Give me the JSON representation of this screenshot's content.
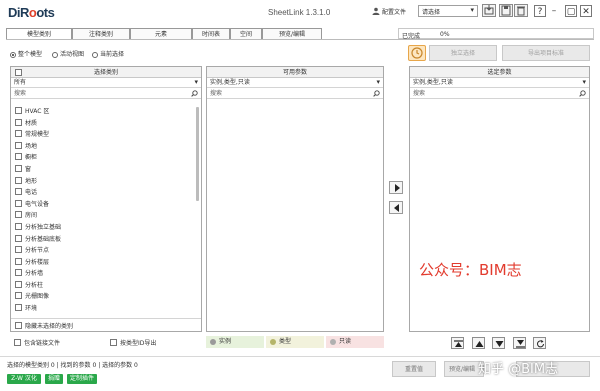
{
  "app": {
    "logo_text": "DiRoots",
    "title": "SheetLink 1.3.1.0",
    "config_label": "配置文件",
    "config_value": "请选择",
    "window_buttons": [
      "?",
      "–",
      "▢",
      "✕"
    ]
  },
  "tabs": [
    {
      "label": "模型类别",
      "active": true
    },
    {
      "label": "注释类别",
      "active": false
    },
    {
      "label": "元素",
      "active": false
    },
    {
      "label": "时间表",
      "active": false
    },
    {
      "label": "空间",
      "active": false
    },
    {
      "label": "预览/编辑",
      "active": false
    }
  ],
  "progress": {
    "label": "已完成",
    "value": "0%"
  },
  "scope": {
    "options": [
      {
        "label": "整个模型",
        "selected": true
      },
      {
        "label": "活动视图",
        "selected": false
      },
      {
        "label": "当前选择",
        "selected": false
      }
    ]
  },
  "actions": {
    "standalone": "独立选择",
    "export_standard": "导出项目标准"
  },
  "categories_panel": {
    "title": "选择类别",
    "filter_value": "所有",
    "search_placeholder": "搜索",
    "items": [
      "HVAC 区",
      "材质",
      "常规模型",
      "场地",
      "橱柜",
      "窗",
      "地形",
      "电话",
      "电气设备",
      "房间",
      "分析独立基础",
      "分析基础底板",
      "分析节点",
      "分析楼层",
      "分析墙",
      "分析柱",
      "光栅图像",
      "环境"
    ],
    "hide_unselected": "隐藏未选择的类别"
  },
  "available_panel": {
    "title": "可用参数",
    "filter_value": "实例,类型,只读",
    "search_placeholder": "搜索"
  },
  "selected_panel": {
    "title": "选定参数",
    "filter_value": "实例,类型,只读",
    "search_placeholder": "搜索"
  },
  "bottom": {
    "include_linked": "包含链接文件",
    "export_by_id": "按类型ID导出",
    "legend": [
      {
        "label": "实例",
        "color": "#9a9a9a",
        "bg": "#e7f2dc"
      },
      {
        "label": "类型",
        "color": "#b5b56a",
        "bg": "#f2f2dc"
      },
      {
        "label": "只读",
        "color": "#b0b0b0",
        "bg": "#f8e2e2"
      }
    ]
  },
  "status_text": "选择的模型类别 0 | 找到的参数 0 | 选择的参数 0",
  "footer": {
    "green_buttons": [
      "Z-W 汉化",
      "捐赠",
      "定制插件"
    ],
    "reset": "重置值",
    "preview": "预览/编辑"
  },
  "watermarks": {
    "zh_account": "公众号：BIM志",
    "zhihu": "知乎 @BIM志"
  },
  "colors": {
    "accent_orange": "#e7a64a",
    "brand_green": "#2aa84a",
    "watermark_red": "#e23b2e"
  }
}
